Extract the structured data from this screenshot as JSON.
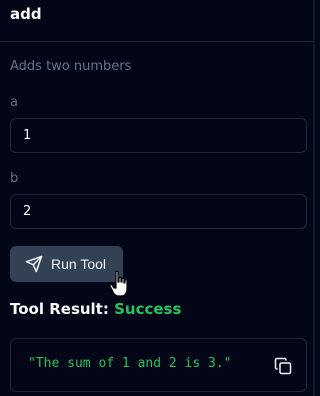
{
  "tool": {
    "name": "add",
    "description": "Adds two numbers"
  },
  "fields": [
    {
      "label": "a",
      "value": "1"
    },
    {
      "label": "b",
      "value": "2"
    }
  ],
  "run_button": {
    "label": "Run Tool",
    "icon": "send-icon"
  },
  "result": {
    "heading": "Tool Result:",
    "status": "Success",
    "output": "\"The sum of 1 and 2 is 3.\"",
    "copy_icon": "copy-icon"
  },
  "colors": {
    "background": "#020617",
    "success": "#22c55e",
    "button": "#334155"
  }
}
